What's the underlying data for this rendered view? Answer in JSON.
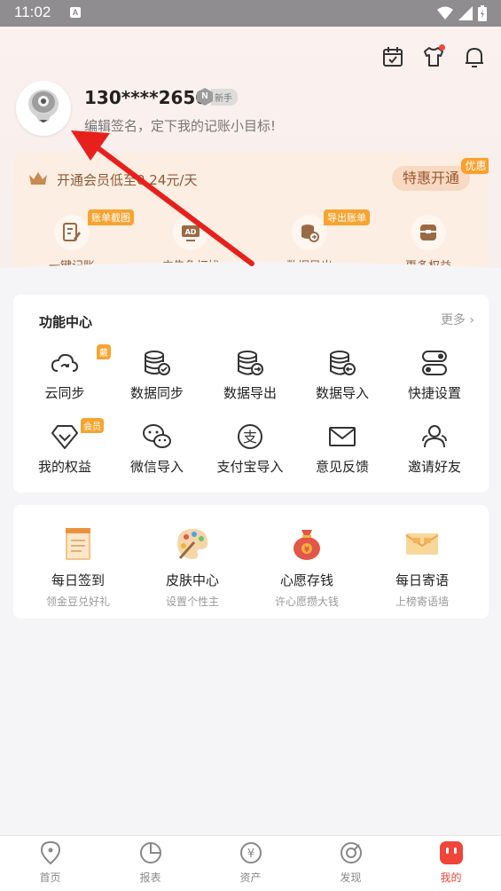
{
  "status_bar": {
    "time": "11:02",
    "notif_letter": "A"
  },
  "profile": {
    "username": "130****2650",
    "level_letter": "N",
    "level_text": "新手",
    "signature": "编辑签名，定下我的记账小目标!"
  },
  "vip": {
    "text": "开通会员低至0.24元/天",
    "open_button": "特惠开通",
    "promo_tag": "优惠",
    "perks": [
      {
        "label": "一键记账",
        "tag": "账单截图"
      },
      {
        "label": "广告免打扰",
        "tag": ""
      },
      {
        "label": "数据导出",
        "tag": "导出账单"
      },
      {
        "label": "更多权益",
        "tag": ""
      }
    ]
  },
  "functions": {
    "title": "功能中心",
    "more": "更多",
    "items": [
      {
        "label": "云同步",
        "tag": "戴"
      },
      {
        "label": "数据同步",
        "tag": ""
      },
      {
        "label": "数据导出",
        "tag": ""
      },
      {
        "label": "数据导入",
        "tag": ""
      },
      {
        "label": "快捷设置",
        "tag": ""
      },
      {
        "label": "我的权益",
        "tag": "会员"
      },
      {
        "label": "微信导入",
        "tag": ""
      },
      {
        "label": "支付宝导入",
        "tag": ""
      },
      {
        "label": "意见反馈",
        "tag": ""
      },
      {
        "label": "邀请好友",
        "tag": ""
      }
    ]
  },
  "daily": [
    {
      "title": "每日签到",
      "subtitle": "领金豆兑好礼"
    },
    {
      "title": "皮肤中心",
      "subtitle": "设置个性主"
    },
    {
      "title": "心愿存钱",
      "subtitle": "许心愿攒大钱"
    },
    {
      "title": "每日寄语",
      "subtitle": "上榜寄语墙"
    }
  ],
  "tabs": [
    {
      "label": "首页",
      "active": false
    },
    {
      "label": "报表",
      "active": false
    },
    {
      "label": "资产",
      "active": false
    },
    {
      "label": "发现",
      "active": false
    },
    {
      "label": "我的",
      "active": true
    }
  ],
  "colors": {
    "accent": "#f0453a",
    "vip_text": "#8a5a36",
    "tag_orange": "#f6a431"
  }
}
